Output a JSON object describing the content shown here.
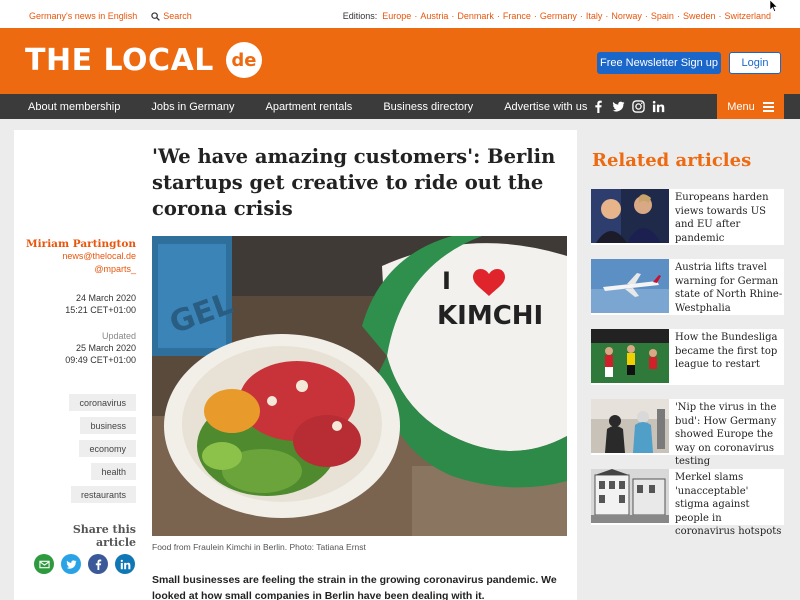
{
  "topbar": {
    "news_link": "Germany's news in English",
    "search_label": "Search",
    "editions_label": "Editions:",
    "editions": [
      "Europe",
      "Austria",
      "Denmark",
      "France",
      "Germany",
      "Italy",
      "Norway",
      "Spain",
      "Sweden",
      "Switzerland"
    ]
  },
  "header": {
    "logo_text": "THE LOCAL",
    "logo_badge": "de",
    "newsletter_label": "Free Newsletter Sign up",
    "login_label": "Login"
  },
  "nav": {
    "items": [
      "About membership",
      "Jobs in Germany",
      "Apartment rentals",
      "Business directory",
      "Advertise with us"
    ],
    "menu_label": "Menu"
  },
  "article": {
    "headline": "'We have amazing customers': Berlin startups get creative to ride out the corona crisis",
    "author": "Miriam Partington",
    "email": "news@thelocal.de",
    "twitter": "@mparts_",
    "date": "24 March 2020",
    "time": "15:21 CET+01:00",
    "updated_label": "Updated",
    "updated_date": "25 March 2020",
    "updated_time": "09:49 CET+01:00",
    "tags": [
      "coronavirus",
      "business",
      "economy",
      "health",
      "restaurants"
    ],
    "share_title": "Share this article",
    "photo_text_line1": "I",
    "photo_text_line2": "KIMCHI",
    "photo_sign_text": "GEL",
    "caption": "Food from Fraulein Kimchi in Berlin. Photo: Tatiana Ernst",
    "lede": "Small businesses are feeling the strain in the growing coronavirus pandemic. We looked at how small companies in Berlin have been dealing with it."
  },
  "related": {
    "title": "Related articles",
    "items": [
      {
        "title": "Europeans harden views towards US and EU after pandemic"
      },
      {
        "title": "Austria lifts travel warning for German state of North Rhine-Westphalia"
      },
      {
        "title": "How the Bundesliga became the first top league to restart"
      },
      {
        "title": "'Nip the virus in the bud': How Germany showed Europe the way on coronavirus testing"
      },
      {
        "title": "Merkel slams 'unacceptable' stigma against people in coronavirus hotspots"
      }
    ]
  },
  "colors": {
    "brand_orange": "#ee6a10",
    "link_orange": "#e8560d",
    "nav_dark": "#3b3b3b",
    "button_blue": "#1a66c9"
  }
}
